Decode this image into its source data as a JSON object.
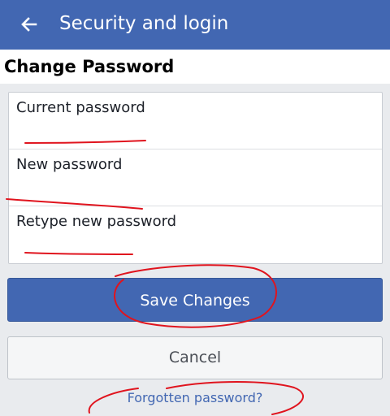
{
  "header": {
    "back_icon": "back-arrow-icon",
    "title": "Security and login"
  },
  "section": {
    "title": "Change Password"
  },
  "form": {
    "fields": [
      {
        "label": "Current password",
        "value": ""
      },
      {
        "label": "New password",
        "value": ""
      },
      {
        "label": "Retype new password",
        "value": ""
      }
    ]
  },
  "buttons": {
    "save_label": "Save Changes",
    "cancel_label": "Cancel"
  },
  "links": {
    "forgot_label": "Forgotten password?"
  },
  "colors": {
    "brand_blue": "#4267b2",
    "page_background": "#e9ebee",
    "annotation_red": "#e0141e"
  }
}
